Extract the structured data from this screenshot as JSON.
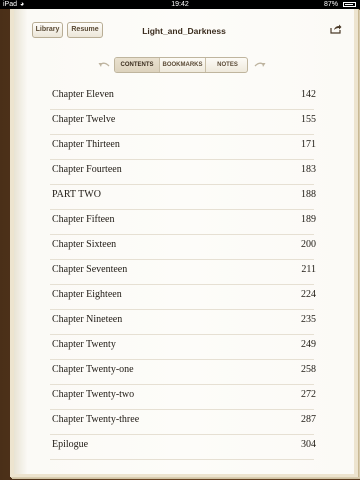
{
  "statusbar": {
    "carrier": "iPad",
    "time": "19:42",
    "battery": "87%"
  },
  "toolbar": {
    "library_label": "Library",
    "resume_label": "Resume",
    "title": "Light_and_Darkness"
  },
  "tabs": [
    {
      "label": "CONTENTS",
      "active": true
    },
    {
      "label": "BOOKMARKS",
      "active": false
    },
    {
      "label": "NOTES",
      "active": false
    }
  ],
  "toc": [
    {
      "title": "Chapter Eleven",
      "page": "142"
    },
    {
      "title": "Chapter Twelve",
      "page": "155"
    },
    {
      "title": "Chapter Thirteen",
      "page": "171"
    },
    {
      "title": "Chapter Fourteen",
      "page": "183"
    },
    {
      "title": "PART TWO",
      "page": "188"
    },
    {
      "title": "Chapter Fifteen",
      "page": "189"
    },
    {
      "title": "Chapter Sixteen",
      "page": "200"
    },
    {
      "title": "Chapter Seventeen",
      "page": "211"
    },
    {
      "title": "Chapter Eighteen",
      "page": "224"
    },
    {
      "title": "Chapter Nineteen",
      "page": "235"
    },
    {
      "title": "Chapter Twenty",
      "page": "249"
    },
    {
      "title": "Chapter Twenty-one",
      "page": "258"
    },
    {
      "title": "Chapter Twenty-two",
      "page": "272"
    },
    {
      "title": "Chapter Twenty-three",
      "page": "287"
    },
    {
      "title": "Epilogue",
      "page": "304"
    }
  ],
  "icons": {
    "share": "share-icon",
    "wifi": "wifi-icon",
    "battery": "battery-icon",
    "prev": "curl-left-icon",
    "next": "curl-right-icon"
  }
}
